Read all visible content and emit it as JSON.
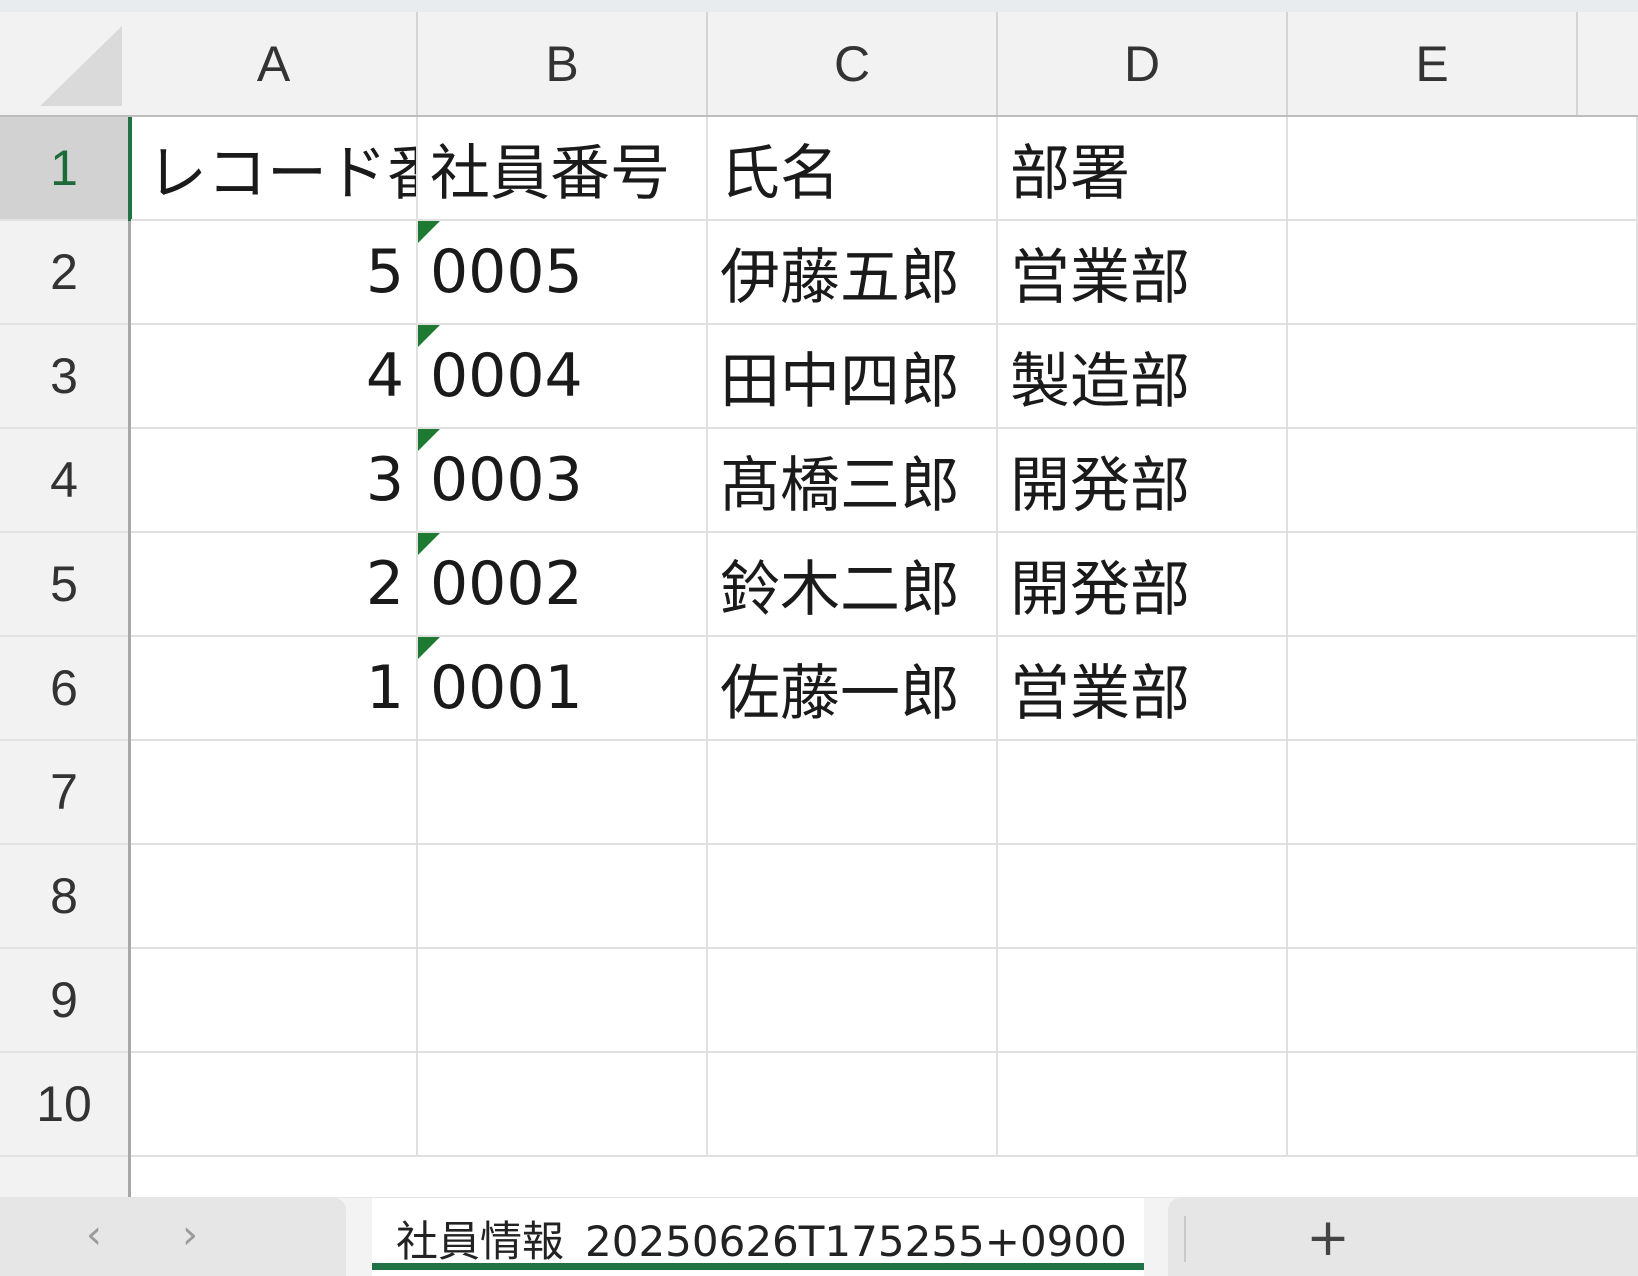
{
  "columns": [
    "A",
    "B",
    "C",
    "D",
    "E"
  ],
  "rows": [
    "1",
    "2",
    "3",
    "4",
    "5",
    "6",
    "7",
    "8",
    "9",
    "10"
  ],
  "header_row": {
    "a": "レコード番号",
    "b": "社員番号",
    "c": "氏名",
    "d": "部署"
  },
  "records": [
    {
      "record_no": "5",
      "employee_no": "0005",
      "name": "伊藤五郎",
      "dept": "営業部"
    },
    {
      "record_no": "4",
      "employee_no": "0004",
      "name": "田中四郎",
      "dept": "製造部"
    },
    {
      "record_no": "3",
      "employee_no": "0003",
      "name": "髙橋三郎",
      "dept": "開発部"
    },
    {
      "record_no": "2",
      "employee_no": "0002",
      "name": "鈴木二郎",
      "dept": "開発部"
    },
    {
      "record_no": "1",
      "employee_no": "0001",
      "name": "佐藤一郎",
      "dept": "営業部"
    }
  ],
  "tabs": {
    "prev_icon": "‹",
    "next_icon": "›",
    "sheet_name": "社員情報_20250626T175255+0900",
    "add_icon": "+"
  },
  "colors": {
    "accent": "#217346",
    "error_triangle": "#1e7a33"
  },
  "selected_row": "1"
}
